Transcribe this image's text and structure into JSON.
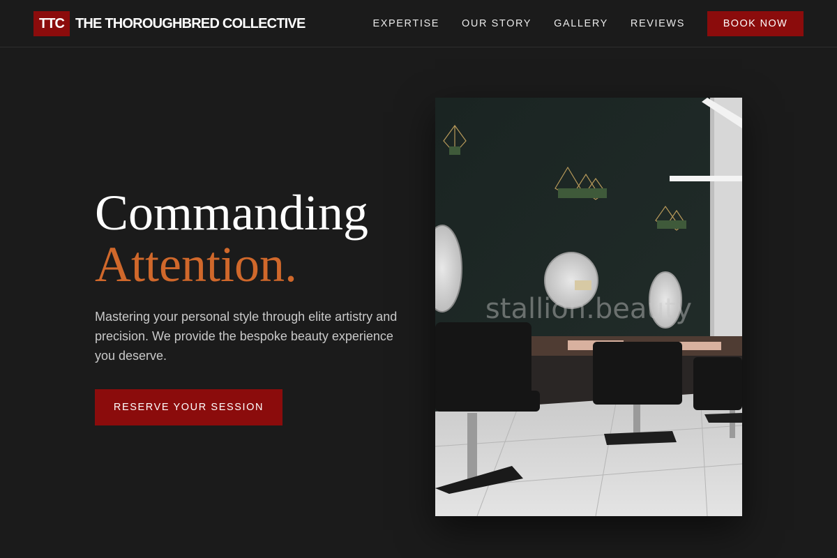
{
  "brand": {
    "mark": "TTC",
    "name": "THE THOROUGHBRED COLLECTIVE"
  },
  "nav": {
    "links": [
      "EXPERTISE",
      "OUR STORY",
      "GALLERY",
      "REVIEWS"
    ],
    "cta": "BOOK NOW"
  },
  "hero": {
    "headline_line1": "Commanding",
    "headline_line2": "Attention.",
    "lead": "Mastering your personal style through elite artistry and precision. We provide the bespoke beauty experience you deserve.",
    "cta": "RESERVE YOUR SESSION"
  },
  "photo": {
    "watermark": "stallion.beauty"
  },
  "colors": {
    "background": "#1b1b1b",
    "brand_red": "#8b0c0c",
    "accent_orange": "#d0682b",
    "body_text": "#c9c9c9"
  }
}
